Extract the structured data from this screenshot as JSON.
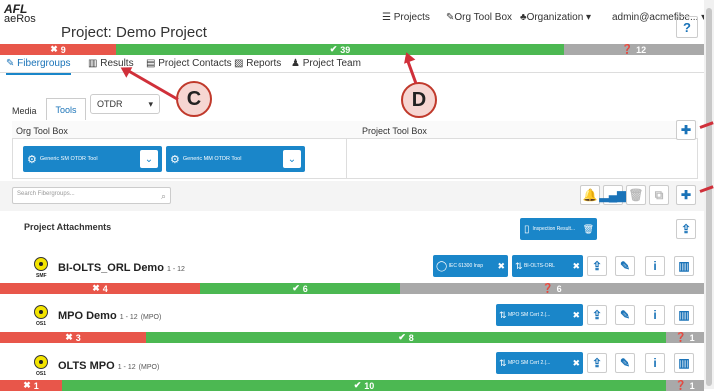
{
  "brand": {
    "top": "AFL",
    "bottom": "aeRos"
  },
  "project_title": "Project: Demo Project",
  "nav": {
    "projects": "Projects",
    "org_tool_box": "Org Tool Box",
    "organization": "Organization",
    "user": "admin@acmefibe...",
    "help": "?"
  },
  "summary_bar": {
    "fail": "9",
    "pass": "39",
    "info": "12"
  },
  "tabs": {
    "fibergroups": "Fibergroups",
    "results": "Results",
    "contacts": "Project Contacts",
    "reports": "Reports",
    "team": "Project Team"
  },
  "subtabs": {
    "media": "Media",
    "tools": "Tools",
    "select": "OTDR"
  },
  "toolbox": {
    "org": "Org Tool Box",
    "project": "Project Tool Box",
    "tool1": "Generic SM OTDR Tool",
    "tool2": "Generic MM OTDR Tool"
  },
  "search": {
    "placeholder": "Search Fibergroups..."
  },
  "attachments": {
    "title": "Project Attachments",
    "file": "Inspection Result..."
  },
  "groups": [
    {
      "name": "BI-OLTS_ORL Demo",
      "range": "1 - 12",
      "fiber": "SMF",
      "tag1": "IEC 61300 Insp",
      "tag2": "BI-OLTS-ORL",
      "fail": "4",
      "pass": "6",
      "info": "6"
    },
    {
      "name": "MPO Demo",
      "range": "1 - 12",
      "note": "(MPO)",
      "fiber": "OS1",
      "tag1": "MPO SM Cert 2.(...",
      "fail": "3",
      "pass": "8",
      "info": "1"
    },
    {
      "name": "OLTS MPO",
      "range": "1 - 12",
      "note": "(MPO)",
      "fiber": "OS1",
      "tag1": "MPO SM Cert 2.(...",
      "fail": "1",
      "pass": "10",
      "info": "1"
    }
  ],
  "callouts": {
    "c": "C",
    "d": "D"
  },
  "colors": {
    "fail": "#e8564a",
    "pass": "#4cb852",
    "info": "#a9a9a9",
    "accent": "#1a86c9"
  }
}
